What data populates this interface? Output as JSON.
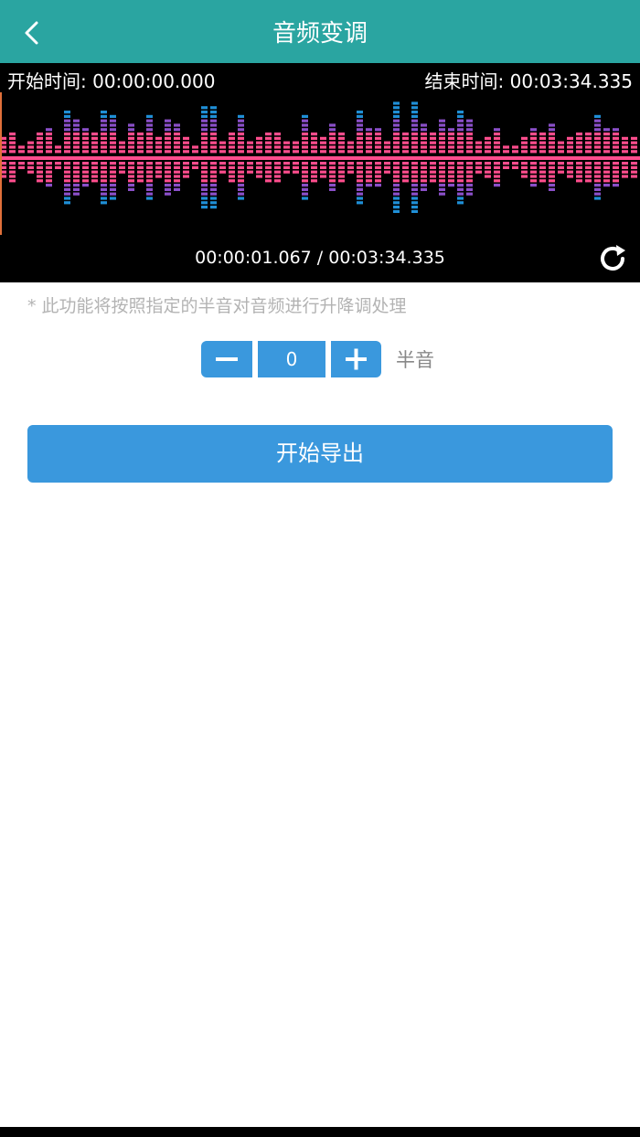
{
  "header": {
    "title": "音频变调",
    "back_icon": "chevron-left-icon"
  },
  "waveform": {
    "start_time_label": "开始时间: 00:00:00.000",
    "end_time_label": "结束时间: 00:03:34.335",
    "progress_text": "00:00:01.067 / 00:03:34.335",
    "refresh_icon": "refresh-icon",
    "colors": {
      "background": "#000000",
      "center": "#ff4d8d",
      "mid": "#8a4fc8",
      "outer": "#1f8fd6",
      "tip": "#19d3a0",
      "playhead": "#e0703a"
    }
  },
  "hint": "* 此功能将按照指定的半音对音频进行升降调处理",
  "pitch": {
    "minus_icon": "minus-icon",
    "plus_icon": "plus-icon",
    "value": "0",
    "unit": "半音"
  },
  "export_button": "开始导出",
  "colors": {
    "header": "#2aa5a1",
    "accent": "#3a98dd",
    "hint": "#b3b3b3"
  }
}
